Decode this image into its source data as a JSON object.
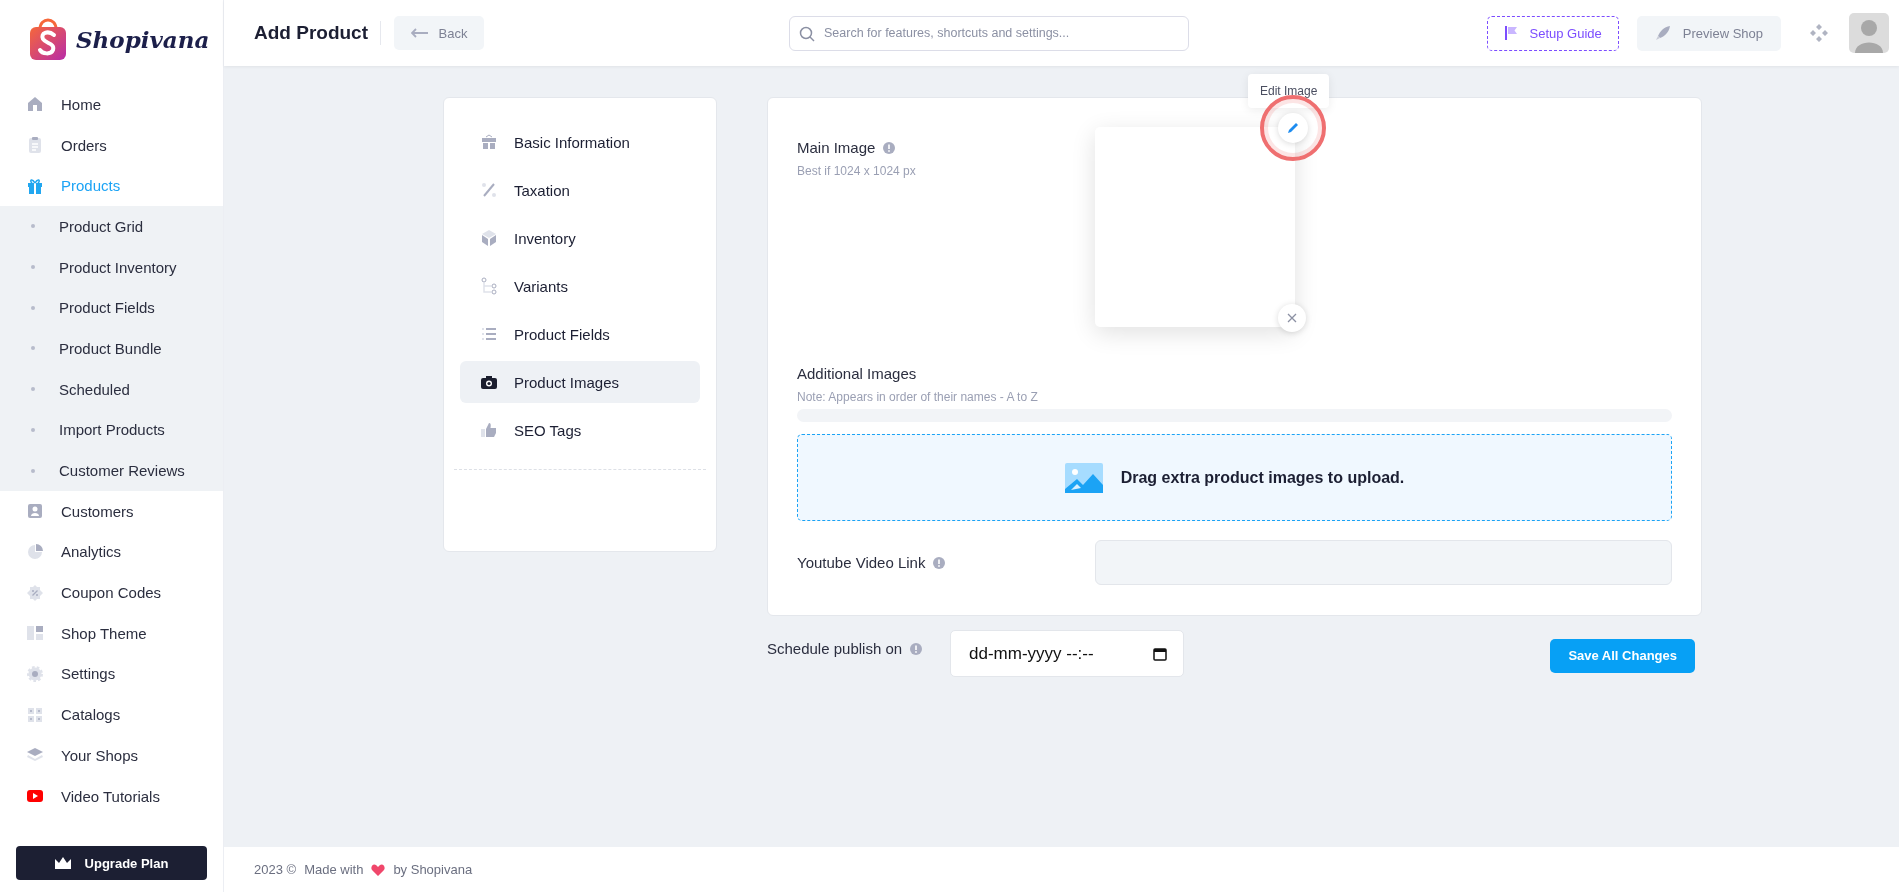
{
  "logo": {
    "text": "Shopivana"
  },
  "sidebar": {
    "items": [
      {
        "label": "Home",
        "selected": false
      },
      {
        "label": "Orders",
        "selected": false
      },
      {
        "label": "Products",
        "selected": true,
        "expanded": true,
        "children": [
          {
            "label": "Product Grid",
            "selected": false
          },
          {
            "label": "Product Inventory",
            "selected": false
          },
          {
            "label": "Product Fields",
            "selected": false
          },
          {
            "label": "Product Bundle",
            "selected": false
          },
          {
            "label": "Scheduled",
            "selected": false
          },
          {
            "label": "Import Products",
            "selected": false
          },
          {
            "label": "Customer Reviews",
            "selected": false
          }
        ]
      },
      {
        "label": "Customers",
        "selected": false
      },
      {
        "label": "Analytics",
        "selected": false
      },
      {
        "label": "Coupon Codes",
        "selected": false
      },
      {
        "label": "Shop Theme",
        "selected": false
      },
      {
        "label": "Settings",
        "selected": false
      },
      {
        "label": "Catalogs",
        "selected": false
      },
      {
        "label": "Your Shops",
        "selected": false
      },
      {
        "label": "Video Tutorials",
        "selected": false
      }
    ],
    "upgrade_button": "Upgrade Plan"
  },
  "header": {
    "title": "Add Product",
    "back_button": "Back",
    "search": {
      "placeholder": "Search for features, shortcuts and settings..."
    },
    "setup_guide": "Setup Guide",
    "preview_shop": "Preview Shop"
  },
  "sections": [
    {
      "label": "Basic Information",
      "selected": false
    },
    {
      "label": "Taxation",
      "selected": false
    },
    {
      "label": "Inventory",
      "selected": false
    },
    {
      "label": "Variants",
      "selected": false
    },
    {
      "label": "Product Fields",
      "selected": false
    },
    {
      "label": "Product Images",
      "selected": true
    },
    {
      "label": "SEO Tags",
      "selected": false
    }
  ],
  "main_image": {
    "label": "Main Image",
    "hint": "Best if 1024 x 1024 px",
    "tooltip": "Edit Image"
  },
  "additional_images": {
    "label": "Additional Images",
    "note": "Note: Appears in order of their names - A to Z",
    "dropzone": "Drag extra product images to upload."
  },
  "youtube": {
    "label": "Youtube Video Link"
  },
  "schedule": {
    "label": "Schedule publish on",
    "placeholder": "dd-mm-yyyy --:--"
  },
  "save_button": "Save All Changes",
  "footer": {
    "year": "2023 ©",
    "made_with": "Made with",
    "by": "by Shopivana"
  }
}
